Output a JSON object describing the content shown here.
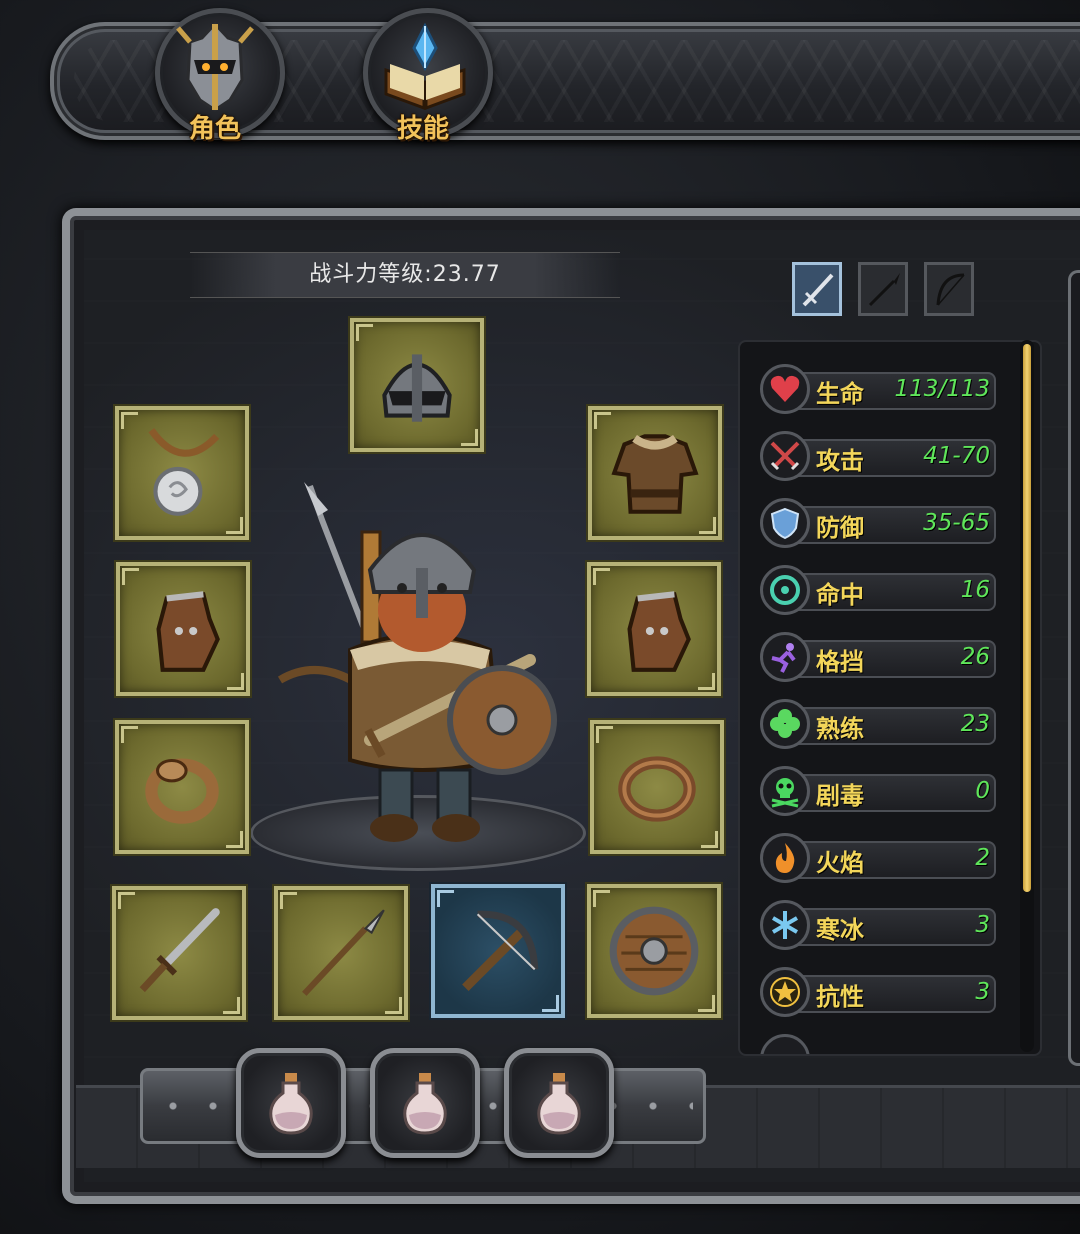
{
  "nav": {
    "tabs": [
      {
        "label": "角色",
        "icon": "helmet-icon"
      },
      {
        "label": "技能",
        "icon": "spellbook-icon"
      }
    ]
  },
  "character": {
    "power_label": "战斗力等级:23.77"
  },
  "equipment": {
    "slots": [
      {
        "name": "helmet-slot",
        "item": "nasal-helmet"
      },
      {
        "name": "amulet-slot",
        "item": "pendant-amulet"
      },
      {
        "name": "armor-slot",
        "item": "leather-armor"
      },
      {
        "name": "left-glove-slot",
        "item": "leather-glove"
      },
      {
        "name": "right-glove-slot",
        "item": "leather-glove"
      },
      {
        "name": "left-ring-slot",
        "item": "ring"
      },
      {
        "name": "right-ring-slot",
        "item": "ring"
      },
      {
        "name": "sword-slot",
        "item": "sword"
      },
      {
        "name": "spear-slot",
        "item": "spear"
      },
      {
        "name": "crossbow-slot",
        "item": "crossbow",
        "selected": true
      },
      {
        "name": "shield-slot",
        "item": "round-shield"
      }
    ]
  },
  "weapon_tabs": [
    {
      "icon": "sword-icon",
      "active": true
    },
    {
      "icon": "spear-icon",
      "active": false
    },
    {
      "icon": "bow-icon",
      "active": false
    }
  ],
  "stats": [
    {
      "name": "生命",
      "value": "113/113",
      "icon": "heart-icon",
      "color": "#e0404a"
    },
    {
      "name": "攻击",
      "value": "41-70",
      "icon": "crossed-swords-icon",
      "color": "#c84848"
    },
    {
      "name": "防御",
      "value": "35-65",
      "icon": "shield-icon",
      "color": "#6aa0d8"
    },
    {
      "name": "命中",
      "value": "16",
      "icon": "target-icon",
      "color": "#4ad0b0"
    },
    {
      "name": "格挡",
      "value": "26",
      "icon": "dodge-icon",
      "color": "#9a60e0"
    },
    {
      "name": "熟练",
      "value": "23",
      "icon": "clover-icon",
      "color": "#5ad860"
    },
    {
      "name": "剧毒",
      "value": "0",
      "icon": "skull-icon",
      "color": "#4ad860"
    },
    {
      "name": "火焰",
      "value": "2",
      "icon": "flame-icon",
      "color": "#f0902a"
    },
    {
      "name": "寒冰",
      "value": "3",
      "icon": "snowflake-icon",
      "color": "#7ac8f0"
    },
    {
      "name": "抗性",
      "value": "3",
      "icon": "star-icon",
      "color": "#f0c040"
    }
  ],
  "potions": [
    {
      "icon": "potion-flask-icon"
    },
    {
      "icon": "potion-flask-icon"
    },
    {
      "icon": "potion-flask-icon"
    }
  ],
  "colors": {
    "stat_name": "#f3d65a",
    "stat_value": "#5fe65a",
    "slot_bg": "#7a7738",
    "nav_label": "#f2c25a"
  }
}
